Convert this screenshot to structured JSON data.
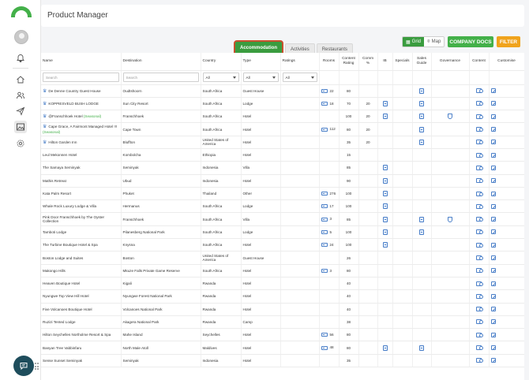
{
  "app": {
    "title": "Product Manager"
  },
  "tabs": [
    {
      "label": "Accommodation",
      "active": true
    },
    {
      "label": "Activities",
      "active": false
    },
    {
      "label": "Restaurants",
      "active": false
    }
  ],
  "view_toggle": {
    "grid": "Grid",
    "map": "Map"
  },
  "buttons": {
    "company_docs": "COMPANY DOCS",
    "filter": "FILTER"
  },
  "columns": [
    "Name",
    "Destination",
    "Country",
    "Type",
    "Ratings",
    "Rooms",
    "Content Rating",
    "Comm %",
    "IB",
    "Specials",
    "Sales Guide",
    "Governance",
    "Content",
    "Customise"
  ],
  "filters": {
    "name_placeholder": "Search",
    "destination_placeholder": "Search",
    "country_value": "All",
    "type_value": "All",
    "ratings_value": "All"
  },
  "rows": [
    {
      "name": "De Denne Country Guest House",
      "crown": true,
      "seasonal": "",
      "destination": "Oudtshoorn",
      "country": "South Africa",
      "type": "Guest House",
      "rooms": "22",
      "content_rating": "80",
      "comm": "",
      "ib": false,
      "sales": true,
      "gov": false,
      "edit": true
    },
    {
      "name": "KOPPIESVELD BUSH LODGE",
      "crown": true,
      "seasonal": "",
      "destination": "Sun City Resort",
      "country": "South Africa",
      "type": "Lodge",
      "rooms": "18",
      "content_rating": "70",
      "comm": "20",
      "ib": true,
      "sales": true,
      "gov": false,
      "edit": true
    },
    {
      "name": "@Franschhoek Hotel",
      "crown": true,
      "seasonal": "(Seasonal)",
      "destination": "Franschhoek",
      "country": "South Africa",
      "type": "Hotel",
      "rooms": "",
      "content_rating": "100",
      "comm": "20",
      "ib": true,
      "sales": true,
      "gov": true,
      "edit": true
    },
    {
      "name": "Cape Grace, A Fairmont Managed Hotel !!!",
      "crown": true,
      "seasonal": "(Seasonal)",
      "destination": "Cape Town",
      "country": "South Africa",
      "type": "Hotel",
      "rooms": "112",
      "content_rating": "80",
      "comm": "20",
      "ib": false,
      "sales": true,
      "gov": false,
      "edit": true
    },
    {
      "name": "Hilton Garden Inn",
      "crown": true,
      "seasonal": "",
      "destination": "Bluffton",
      "country": "United States of America",
      "type": "Hotel",
      "rooms": "",
      "content_rating": "35",
      "comm": "20",
      "ib": false,
      "sales": true,
      "gov": false,
      "edit": true
    },
    {
      "name": "Leul Mekonnen Hotel",
      "crown": false,
      "seasonal": "",
      "destination": "Kombolcha",
      "country": "Ethiopia",
      "type": "Hotel",
      "rooms": "",
      "content_rating": "15",
      "comm": "",
      "ib": false,
      "sales": false,
      "gov": false,
      "edit": true
    },
    {
      "name": "The Samaya Seminyak",
      "crown": false,
      "seasonal": "",
      "destination": "Seminyak",
      "country": "Indonesia",
      "type": "Villa",
      "rooms": "",
      "content_rating": "85",
      "comm": "",
      "ib": true,
      "sales": false,
      "gov": false,
      "edit": true
    },
    {
      "name": "Mathis Retreat",
      "crown": false,
      "seasonal": "",
      "destination": "Ubud",
      "country": "Indonesia",
      "type": "Hotel",
      "rooms": "",
      "content_rating": "90",
      "comm": "",
      "ib": true,
      "sales": false,
      "gov": false,
      "edit": true
    },
    {
      "name": "Kata Palm Resort",
      "crown": false,
      "seasonal": "",
      "destination": "Phuket",
      "country": "Thailand",
      "type": "Other",
      "rooms": "276",
      "content_rating": "100",
      "comm": "",
      "ib": true,
      "sales": false,
      "gov": false,
      "edit": true
    },
    {
      "name": "Whale Rock Luxury Lodge & Villa",
      "crown": false,
      "seasonal": "",
      "destination": "Hermanus",
      "country": "South Africa",
      "type": "Lodge",
      "rooms": "17",
      "content_rating": "100",
      "comm": "",
      "ib": true,
      "sales": false,
      "gov": false,
      "edit": true
    },
    {
      "name": "Pink Door Franschhoek by The Oyster Collection",
      "crown": false,
      "seasonal": "",
      "destination": "Franschhoek",
      "country": "South Africa",
      "type": "Villa",
      "rooms": "3",
      "content_rating": "85",
      "comm": "",
      "ib": true,
      "sales": true,
      "gov": true,
      "edit": true
    },
    {
      "name": "Tamboti Lodge",
      "crown": false,
      "seasonal": "",
      "destination": "Pilanesberg National Park",
      "country": "South Africa",
      "type": "Lodge",
      "rooms": "5",
      "content_rating": "100",
      "comm": "",
      "ib": true,
      "sales": true,
      "gov": false,
      "edit": true
    },
    {
      "name": "The Turbine Boutique Hotel & Spa",
      "crown": false,
      "seasonal": "",
      "destination": "Knysna",
      "country": "South Africa",
      "type": "Hotel",
      "rooms": "24",
      "content_rating": "100",
      "comm": "",
      "ib": true,
      "sales": false,
      "gov": false,
      "edit": true
    },
    {
      "name": "Boston Lodge and Suites",
      "crown": false,
      "seasonal": "",
      "destination": "Boston",
      "country": "United States of America",
      "type": "Guest House",
      "rooms": "",
      "content_rating": "26",
      "comm": "",
      "ib": false,
      "sales": false,
      "gov": false,
      "edit": true
    },
    {
      "name": "Makongo Hills",
      "crown": false,
      "seasonal": "",
      "destination": "Mkuze Falls Private Game Reserve",
      "country": "South Africa",
      "type": "Hotel",
      "rooms": "3",
      "content_rating": "80",
      "comm": "",
      "ib": false,
      "sales": false,
      "gov": false,
      "edit": true
    },
    {
      "name": "Heaven Boutique Hotel",
      "crown": false,
      "seasonal": "",
      "destination": "Kigali",
      "country": "Rwanda",
      "type": "Hotel",
      "rooms": "",
      "content_rating": "40",
      "comm": "",
      "ib": false,
      "sales": false,
      "gov": false,
      "edit": true
    },
    {
      "name": "Nyungwe Top View Hill Hotel",
      "crown": false,
      "seasonal": "",
      "destination": "Nyungwe Forest National Park",
      "country": "Rwanda",
      "type": "Hotel",
      "rooms": "",
      "content_rating": "40",
      "comm": "",
      "ib": false,
      "sales": false,
      "gov": false,
      "edit": true
    },
    {
      "name": "Five Volcanoes Boutique Hotel",
      "crown": false,
      "seasonal": "",
      "destination": "Volcanoes National Park",
      "country": "Rwanda",
      "type": "Hotel",
      "rooms": "",
      "content_rating": "40",
      "comm": "",
      "ib": false,
      "sales": false,
      "gov": false,
      "edit": true
    },
    {
      "name": "Ruzizi Tented Lodge",
      "crown": false,
      "seasonal": "",
      "destination": "Akagera National Park",
      "country": "Rwanda",
      "type": "Camp",
      "rooms": "",
      "content_rating": "38",
      "comm": "",
      "ib": false,
      "sales": false,
      "gov": false,
      "edit": true
    },
    {
      "name": "Hilton Seychelles Northolme Resort & Spa",
      "crown": false,
      "seasonal": "",
      "destination": "Mahe Island",
      "country": "Seychelles",
      "type": "Hotel",
      "rooms": "56",
      "content_rating": "80",
      "comm": "",
      "ib": false,
      "sales": false,
      "gov": false,
      "edit": true
    },
    {
      "name": "Banyan Tree Vabbinfaru",
      "crown": false,
      "seasonal": "",
      "destination": "North Male Atoll",
      "country": "Maldives",
      "type": "Hotel",
      "rooms": "48",
      "content_rating": "80",
      "comm": "",
      "ib": true,
      "sales": true,
      "gov": false,
      "edit": true
    },
    {
      "name": "Sense Sunset Seminyak",
      "crown": false,
      "seasonal": "",
      "destination": "Seminyak",
      "country": "Indonesia",
      "type": "Hotel",
      "rooms": "",
      "content_rating": "35",
      "comm": "",
      "ib": false,
      "sales": false,
      "gov": false,
      "edit": true
    }
  ],
  "icons": {
    "bell": "bell-icon",
    "home": "home-icon",
    "users": "users-icon",
    "send": "send-icon",
    "image": "image-icon",
    "settings": "gear-icon",
    "chat": "chat-icon"
  },
  "colors": {
    "brand_green": "#43b049",
    "active_tab": "#3a9c3f",
    "filter_orange": "#f0a31c",
    "icon_blue": "#4a7fc8",
    "tab_highlight": "#c8502d"
  }
}
